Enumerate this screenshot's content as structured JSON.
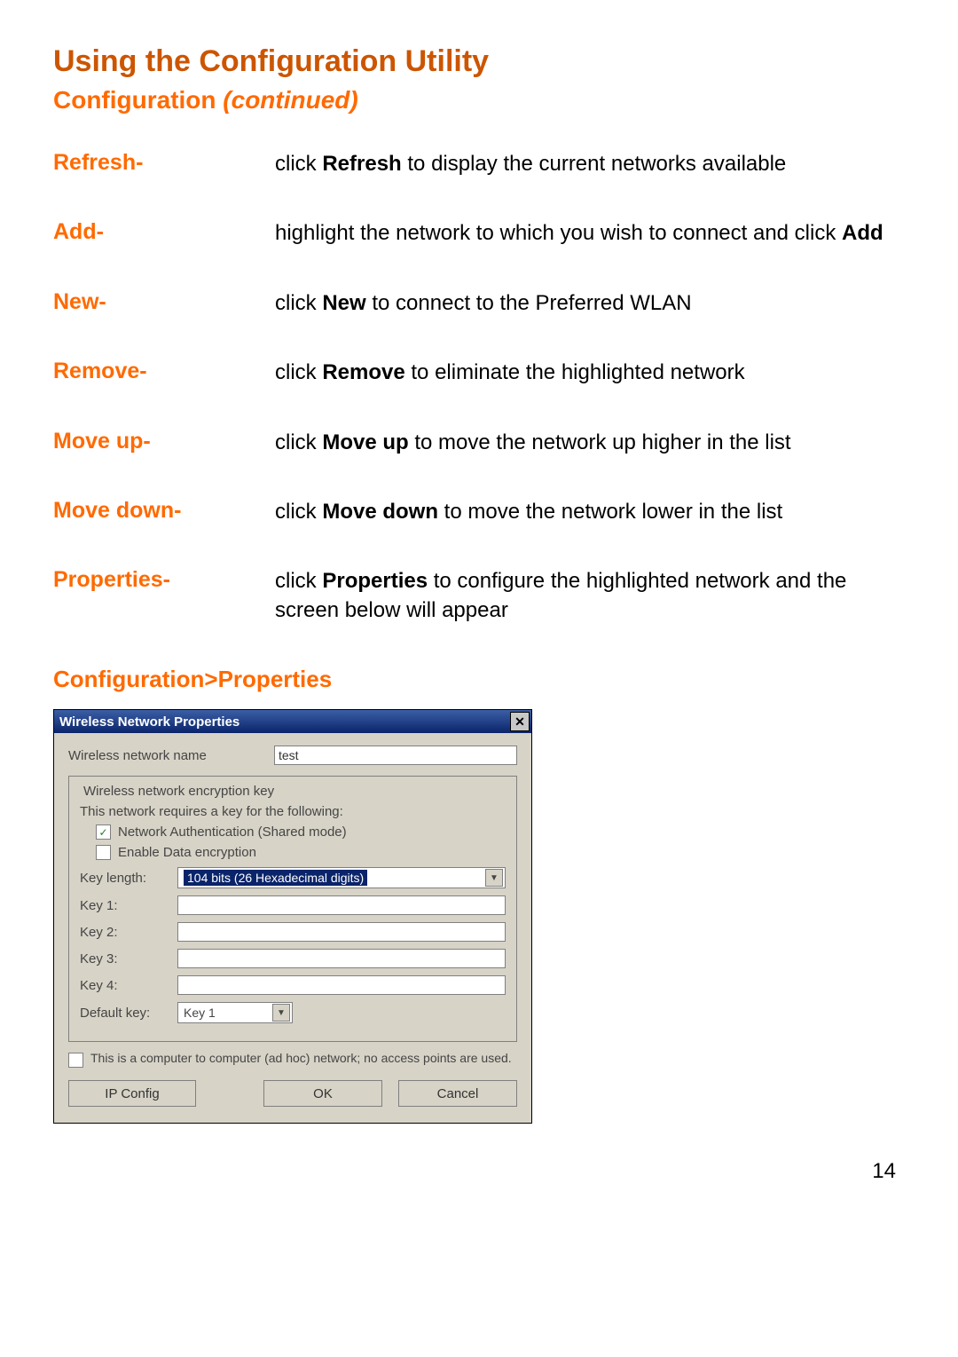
{
  "title": "Using the Configuration Utility",
  "subtitle_plain": "Configuration ",
  "subtitle_italic": "(continued)",
  "items": [
    {
      "label": "Refresh-",
      "pre": "click ",
      "bold": "Refresh",
      "post": " to display the current networks available"
    },
    {
      "label": "Add-",
      "pre": "highlight the network to which you wish to connect and click ",
      "bold": "Add",
      "post": ""
    },
    {
      "label": "New-",
      "pre": "click ",
      "bold": "New",
      "post": " to connect to the Preferred WLAN"
    },
    {
      "label": "Remove-",
      "pre": "click ",
      "bold": "Remove",
      "post": " to eliminate the highlighted network"
    },
    {
      "label": "Move up-",
      "pre": "click ",
      "bold": "Move up",
      "post": " to move the network up higher in the list"
    },
    {
      "label": "Move down-",
      "pre": "click ",
      "bold": "Move down",
      "post": " to move the network lower in the list"
    },
    {
      "label": "Properties-",
      "pre": "click ",
      "bold": "Properties",
      "post": " to configure the highlighted network and the screen below will appear"
    }
  ],
  "section_label": "Configuration>Properties",
  "dialog": {
    "title": "Wireless Network Properties",
    "close_glyph": "✕",
    "network_name_label": "Wireless network name",
    "network_name_value": "test",
    "group_legend": "Wireless network encryption key",
    "group_intro": "This network requires a key for the following:",
    "chk_auth_label": "Network  Authentication (Shared mode)",
    "chk_auth_checked": "✓",
    "chk_enc_label": "Enable Data encryption",
    "chk_enc_checked": "",
    "key_length_label": "Key length:",
    "key_length_value": "104 bits (26 Hexadecimal digits)",
    "keys": [
      "Key 1:",
      "Key 2:",
      "Key 3:",
      "Key 4:"
    ],
    "key_values": [
      "",
      "",
      "",
      ""
    ],
    "default_key_label": "Default key:",
    "default_key_value": "Key 1",
    "caret_glyph": "▼",
    "adhoc_label": "This is a computer to computer (ad hoc) network; no access points are used.",
    "adhoc_checked": "",
    "ip_config_btn": "IP Config",
    "ok_btn": "OK",
    "cancel_btn": "Cancel"
  },
  "page_number": "14"
}
